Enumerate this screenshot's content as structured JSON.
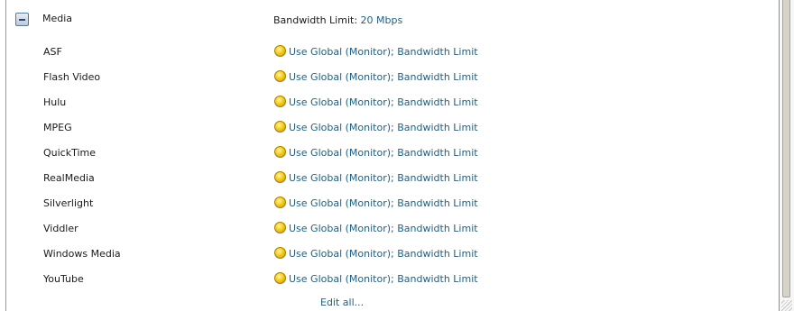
{
  "group": {
    "title": "Media",
    "summary_label": "Bandwidth Limit: ",
    "summary_value": "20 Mbps"
  },
  "rows": [
    {
      "name": "ASF",
      "policy": "Use Global (Monitor); Bandwidth Limit"
    },
    {
      "name": "Flash Video",
      "policy": "Use Global (Monitor); Bandwidth Limit"
    },
    {
      "name": "Hulu",
      "policy": "Use Global (Monitor); Bandwidth Limit"
    },
    {
      "name": "MPEG",
      "policy": "Use Global (Monitor); Bandwidth Limit"
    },
    {
      "name": "QuickTime",
      "policy": "Use Global (Monitor); Bandwidth Limit"
    },
    {
      "name": "RealMedia",
      "policy": "Use Global (Monitor); Bandwidth Limit"
    },
    {
      "name": "Silverlight",
      "policy": "Use Global (Monitor); Bandwidth Limit"
    },
    {
      "name": "Viddler",
      "policy": "Use Global (Monitor); Bandwidth Limit"
    },
    {
      "name": "Windows Media",
      "policy": "Use Global (Monitor); Bandwidth Limit"
    },
    {
      "name": "YouTube",
      "policy": "Use Global (Monitor); Bandwidth Limit"
    }
  ],
  "edit_all_label": "Edit all...",
  "icons": {
    "toggle": "collapse-minus-icon",
    "status": "yellow-circle-icon"
  },
  "colors": {
    "link": "#1f5f80",
    "status_icon": "#f3cd1a"
  }
}
